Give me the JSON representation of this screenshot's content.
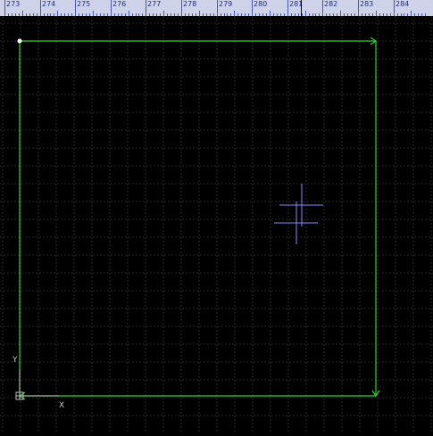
{
  "ruler": {
    "labels": [
      "273",
      "274",
      "275",
      "276",
      "277",
      "278",
      "279",
      "280",
      "281",
      "282",
      "283",
      "284"
    ]
  },
  "axes": {
    "x_label": "X",
    "y_label": "Y"
  },
  "colors": {
    "background": "#000000",
    "grid": "#2a2a2a",
    "boundary": "#34d12e",
    "crosshair": "#8a86ff",
    "ruler_bg": "#cfd3ea",
    "ruler_text": "#1f2f7a"
  },
  "icons": {
    "origin": "origin-marker-icon",
    "start_point": "start-point-icon",
    "crosshair": "crosshair-cursor-icon"
  }
}
